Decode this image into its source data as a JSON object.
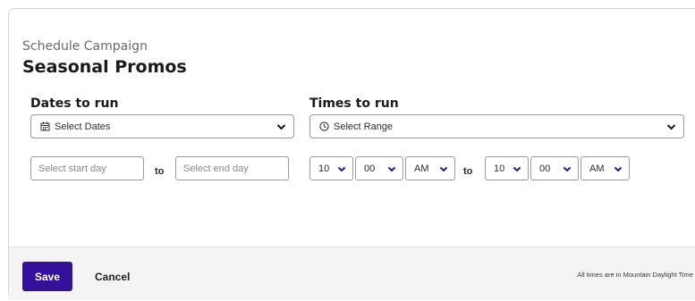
{
  "header": {
    "subtitle": "Schedule Campaign",
    "title": "Seasonal Promos"
  },
  "dates": {
    "label": "Dates to run",
    "select_label": "Select Dates",
    "icon": "calendar-icon",
    "start_placeholder": "Select start day",
    "end_placeholder": "Select end day",
    "to_label": "to"
  },
  "times": {
    "label": "Times to run",
    "select_label": "Select Range",
    "icon": "clock-icon",
    "to_label": "to",
    "start": {
      "hour": "10",
      "minute": "00",
      "period": "AM"
    },
    "end": {
      "hour": "10",
      "minute": "00",
      "period": "AM"
    }
  },
  "footer": {
    "save_label": "Save",
    "cancel_label": "Cancel",
    "timezone_note": "All times are in Mountain Daylight Time"
  },
  "colors": {
    "primary": "#33119c",
    "footer_bg": "#f4f4f4",
    "border": "#9a9a9a"
  }
}
